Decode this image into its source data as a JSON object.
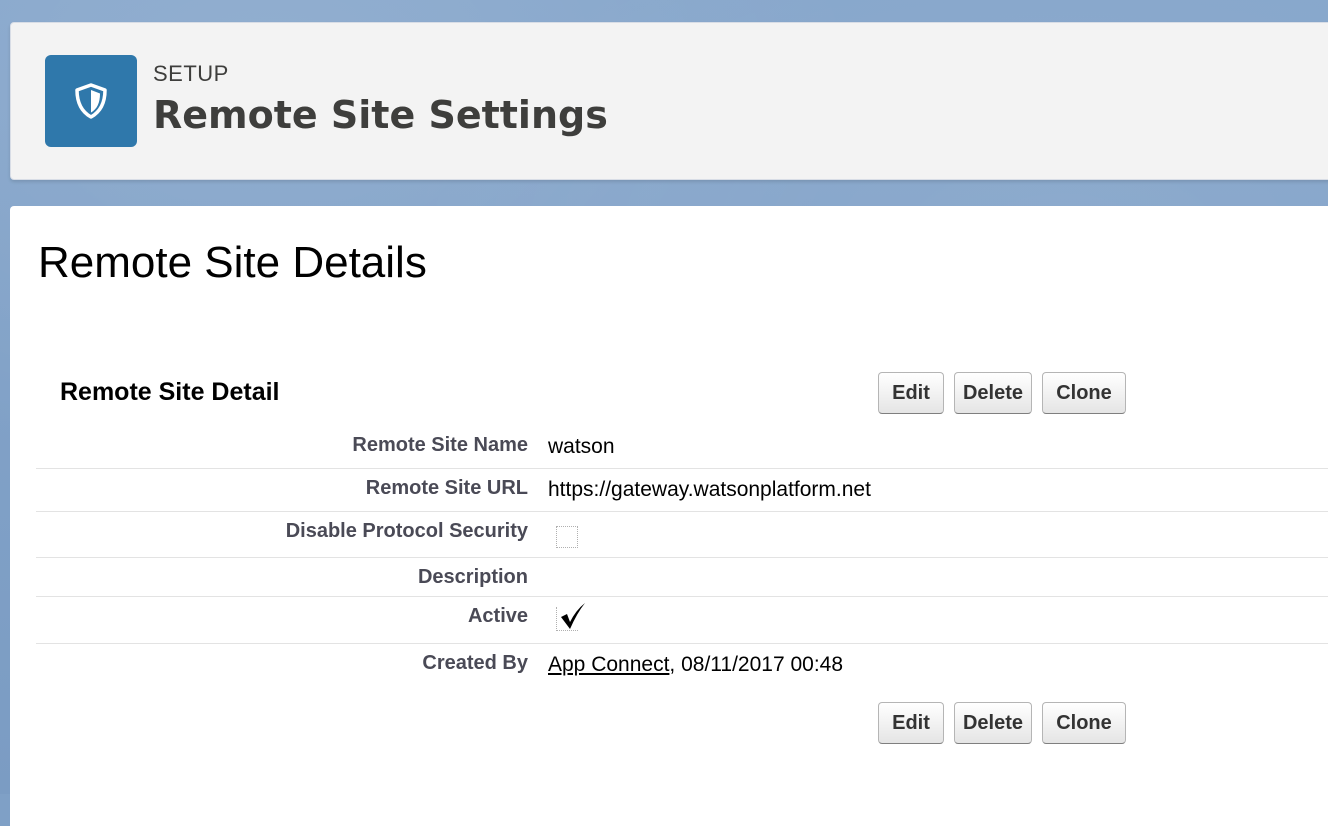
{
  "header": {
    "eyebrow": "SETUP",
    "title": "Remote Site Settings",
    "icon": "shield-icon",
    "icon_bg": "#2f78ab"
  },
  "page": {
    "title": "Remote Site Details"
  },
  "section": {
    "title": "Remote Site Detail"
  },
  "buttons": {
    "edit": "Edit",
    "delete": "Delete",
    "clone": "Clone"
  },
  "fields": {
    "name": {
      "label": "Remote Site Name",
      "value": "watson"
    },
    "url": {
      "label": "Remote Site URL",
      "value": "https://gateway.watsonplatform.net"
    },
    "disable_protocol_security": {
      "label": "Disable Protocol Security",
      "checked": false
    },
    "description": {
      "label": "Description",
      "value": ""
    },
    "active": {
      "label": "Active",
      "checked": true
    },
    "created_by": {
      "label": "Created By",
      "user": "App Connect",
      "timestamp": ", 08/11/2017 00:48"
    }
  }
}
